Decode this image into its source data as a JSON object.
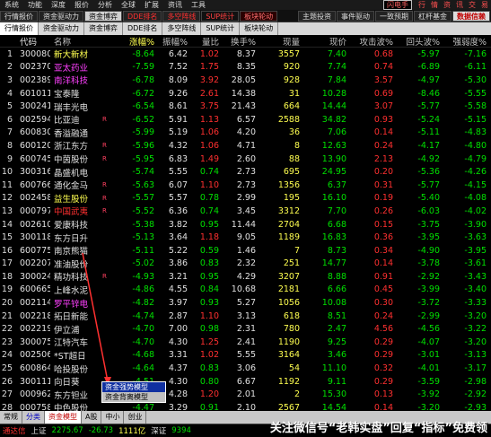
{
  "menubar": {
    "items": [
      "系统",
      "功能",
      "深度",
      "报价",
      "分析",
      "全球",
      "扩展",
      "资讯",
      "工具"
    ],
    "right": {
      "box": "闪电手",
      "items": [
        "行",
        "情",
        "资",
        "讯",
        "交",
        "易"
      ]
    }
  },
  "toolbar": {
    "items": [
      "行情报价",
      "资金驱动力",
      "资金博弈",
      "DDE排名",
      "多空阵线",
      "SUP统计",
      "板块轮动"
    ],
    "right": [
      "主题投资",
      "事件驱动",
      "一致预期",
      "杠杆基金",
      "数据信赖"
    ]
  },
  "subtoolbar": {
    "items": [
      "行情报价",
      "资金驱动力",
      "资金博弈",
      "DDE排名",
      "多空阵线",
      "SUP统计",
      "板块轮动"
    ]
  },
  "table": {
    "headers": [
      "",
      "代码",
      "名称",
      "涨幅%",
      "振幅%",
      "量比",
      "换手%",
      "现量",
      "现价",
      "攻击波%",
      "回头波%",
      "强弱度%"
    ],
    "rows": [
      {
        "n": "1",
        "code": "300080",
        "name": "新大新材",
        "flag": "",
        "chg": "-8.64",
        "amp": "6.42",
        "lb": "1.02",
        "hs": "8.37",
        "xl": "3557",
        "xj": "7.40",
        "gjb": "0.68",
        "htb": "-5.97",
        "qrd": "-7.16",
        "nc": "yel"
      },
      {
        "n": "2",
        "code": "002370",
        "name": "亚太药业",
        "flag": "",
        "chg": "-7.59",
        "amp": "7.52",
        "lb": "1.75",
        "hs": "8.35",
        "xl": "920",
        "xj": "7.74",
        "gjb": "0.74",
        "htb": "-6.89",
        "qrd": "-6.11",
        "nc": "mg"
      },
      {
        "n": "3",
        "code": "002389",
        "name": "南洋科技",
        "flag": "",
        "chg": "-6.78",
        "amp": "8.09",
        "lb": "3.92",
        "hs": "28.05",
        "xl": "928",
        "xj": "7.84",
        "gjb": "3.57",
        "htb": "-4.97",
        "qrd": "-5.30",
        "nc": "mg"
      },
      {
        "n": "4",
        "code": "601011",
        "name": "宝泰隆",
        "flag": "",
        "chg": "-6.72",
        "amp": "9.26",
        "lb": "2.61",
        "hs": "14.38",
        "xl": "31",
        "xj": "10.28",
        "gjb": "0.69",
        "htb": "-8.46",
        "qrd": "-5.55",
        "nc": "wh"
      },
      {
        "n": "5",
        "code": "300241",
        "name": "瑞丰光电",
        "flag": "",
        "chg": "-6.54",
        "amp": "8.61",
        "lb": "3.75",
        "hs": "21.43",
        "xl": "664",
        "xj": "14.44",
        "gjb": "3.07",
        "htb": "-5.77",
        "qrd": "-5.58",
        "nc": "wh"
      },
      {
        "n": "6",
        "code": "002594",
        "name": "比亚迪",
        "flag": "R",
        "chg": "-6.52",
        "amp": "5.91",
        "lb": "1.13",
        "hs": "6.57",
        "xl": "2588",
        "xj": "34.82",
        "gjb": "0.93",
        "htb": "-5.24",
        "qrd": "-5.15",
        "nc": "wh"
      },
      {
        "n": "7",
        "code": "600830",
        "name": "香溢融通",
        "flag": "",
        "chg": "-5.99",
        "amp": "5.19",
        "lb": "1.06",
        "hs": "4.20",
        "xl": "36",
        "xj": "7.06",
        "gjb": "0.14",
        "htb": "-5.11",
        "qrd": "-4.83",
        "nc": "wh"
      },
      {
        "n": "8",
        "code": "600120",
        "name": "浙江东方",
        "flag": "R",
        "chg": "-5.96",
        "amp": "4.32",
        "lb": "1.06",
        "hs": "4.71",
        "xl": "8",
        "xj": "12.63",
        "gjb": "0.24",
        "htb": "-4.17",
        "qrd": "-4.80",
        "nc": "wh"
      },
      {
        "n": "9",
        "code": "600745",
        "name": "中茵股份",
        "flag": "R",
        "chg": "-5.95",
        "amp": "6.83",
        "lb": "1.49",
        "hs": "2.60",
        "xl": "88",
        "xj": "13.90",
        "gjb": "2.13",
        "htb": "-4.92",
        "qrd": "-4.79",
        "nc": "wh"
      },
      {
        "n": "10",
        "code": "300316",
        "name": "晶盛机电",
        "flag": "",
        "chg": "-5.74",
        "amp": "5.55",
        "lb": "0.74",
        "hs": "2.73",
        "xl": "695",
        "xj": "24.95",
        "gjb": "0.20",
        "htb": "-5.36",
        "qrd": "-4.26",
        "nc": "wh"
      },
      {
        "n": "11",
        "code": "600766",
        "name": "通化金马",
        "flag": "R",
        "chg": "-5.63",
        "amp": "6.07",
        "lb": "1.10",
        "hs": "2.73",
        "xl": "1356",
        "xj": "6.37",
        "gjb": "0.31",
        "htb": "-5.77",
        "qrd": "-4.15",
        "nc": "wh"
      },
      {
        "n": "12",
        "code": "002458",
        "name": "益生股份",
        "flag": "R",
        "chg": "-5.57",
        "amp": "5.57",
        "lb": "0.78",
        "hs": "2.99",
        "xl": "195",
        "xj": "16.10",
        "gjb": "0.19",
        "htb": "-5.40",
        "qrd": "-4.08",
        "nc": "yel"
      },
      {
        "n": "13",
        "code": "000797",
        "name": "中国武夷",
        "flag": "R",
        "chg": "-5.52",
        "amp": "6.36",
        "lb": "0.74",
        "hs": "3.45",
        "xl": "3312",
        "xj": "7.70",
        "gjb": "0.26",
        "htb": "-6.03",
        "qrd": "-4.02",
        "nc": "nm-red"
      },
      {
        "n": "14",
        "code": "002610",
        "name": "爱康科技",
        "flag": "",
        "chg": "-5.38",
        "amp": "3.82",
        "lb": "0.95",
        "hs": "11.44",
        "xl": "2704",
        "xj": "6.68",
        "gjb": "0.15",
        "htb": "-3.75",
        "qrd": "-3.90",
        "nc": "wh"
      },
      {
        "n": "15",
        "code": "300118",
        "name": "东方日升",
        "flag": "",
        "chg": "-5.13",
        "amp": "3.64",
        "lb": "1.18",
        "hs": "9.05",
        "xl": "1189",
        "xj": "16.83",
        "gjb": "0.36",
        "htb": "-3.95",
        "qrd": "-3.63",
        "nc": "wh"
      },
      {
        "n": "16",
        "code": "600775",
        "name": "南京熊猫",
        "flag": "",
        "chg": "-5.11",
        "amp": "5.22",
        "lb": "0.59",
        "hs": "1.46",
        "xl": "7",
        "xj": "8.73",
        "gjb": "0.34",
        "htb": "-4.90",
        "qrd": "-3.95",
        "nc": "wh"
      },
      {
        "n": "17",
        "code": "002207",
        "name": "准油股份",
        "flag": "",
        "chg": "-5.02",
        "amp": "3.86",
        "lb": "0.83",
        "hs": "2.32",
        "xl": "251",
        "xj": "14.77",
        "gjb": "0.14",
        "htb": "-3.78",
        "qrd": "-3.61",
        "nc": "wh"
      },
      {
        "n": "18",
        "code": "300024",
        "name": "精功科技",
        "flag": "R",
        "chg": "-4.93",
        "amp": "3.21",
        "lb": "0.95",
        "hs": "4.29",
        "xl": "3207",
        "xj": "8.88",
        "gjb": "0.91",
        "htb": "-2.92",
        "qrd": "-3.43",
        "nc": "wh"
      },
      {
        "n": "19",
        "code": "600665",
        "name": "上峰水泥",
        "flag": "",
        "chg": "-4.86",
        "amp": "4.55",
        "lb": "0.84",
        "hs": "10.68",
        "xl": "2181",
        "xj": "6.66",
        "gjb": "0.45",
        "htb": "-3.99",
        "qrd": "-3.40",
        "nc": "wh"
      },
      {
        "n": "20",
        "code": "002114",
        "name": "罗平锌电",
        "flag": "",
        "chg": "-4.82",
        "amp": "3.97",
        "lb": "0.93",
        "hs": "5.27",
        "xl": "1056",
        "xj": "10.08",
        "gjb": "0.30",
        "htb": "-3.72",
        "qrd": "-3.33",
        "nc": "mg"
      },
      {
        "n": "21",
        "code": "002218",
        "name": "拓日新能",
        "flag": "",
        "chg": "-4.74",
        "amp": "2.87",
        "lb": "1.10",
        "hs": "3.13",
        "xl": "618",
        "xj": "8.51",
        "gjb": "0.24",
        "htb": "-2.99",
        "qrd": "-3.20",
        "nc": "wh"
      },
      {
        "n": "22",
        "code": "002219",
        "name": "伊立浦",
        "flag": "",
        "chg": "-4.70",
        "amp": "7.00",
        "lb": "0.98",
        "hs": "2.31",
        "xl": "780",
        "xj": "2.47",
        "gjb": "4.56",
        "htb": "-4.56",
        "qrd": "-3.22",
        "nc": "wh"
      },
      {
        "n": "23",
        "code": "300075",
        "name": "江特汽车",
        "flag": "",
        "chg": "-4.70",
        "amp": "4.30",
        "lb": "1.25",
        "hs": "2.41",
        "xl": "1190",
        "xj": "9.25",
        "gjb": "0.29",
        "htb": "-4.07",
        "qrd": "-3.20",
        "nc": "wh"
      },
      {
        "n": "24",
        "code": "002506",
        "name": "*ST超日",
        "flag": "",
        "chg": "-4.68",
        "amp": "3.31",
        "lb": "1.02",
        "hs": "5.55",
        "xl": "3164",
        "xj": "3.46",
        "gjb": "0.29",
        "htb": "-3.01",
        "qrd": "-3.13",
        "nc": "wh"
      },
      {
        "n": "25",
        "code": "600864",
        "name": "哈投股份",
        "flag": "",
        "chg": "-4.64",
        "amp": "4.37",
        "lb": "0.83",
        "hs": "3.06",
        "xl": "54",
        "xj": "11.10",
        "gjb": "0.32",
        "htb": "-4.01",
        "qrd": "-3.17",
        "nc": "wh"
      },
      {
        "n": "26",
        "code": "300111",
        "name": "向日葵",
        "flag": "",
        "chg": "-4.51",
        "amp": "4.30",
        "lb": "0.80",
        "hs": "6.67",
        "xl": "1192",
        "xj": "9.11",
        "gjb": "0.29",
        "htb": "-3.59",
        "qrd": "-2.98",
        "nc": "wh"
      },
      {
        "n": "27",
        "code": "000962",
        "name": "东方钽业",
        "flag": "",
        "chg": "-4.49",
        "amp": "4.28",
        "lb": "1.20",
        "hs": "2.01",
        "xl": "2",
        "xj": "15.30",
        "gjb": "0.13",
        "htb": "-3.92",
        "qrd": "-2.92",
        "nc": "wh"
      },
      {
        "n": "28",
        "code": "000758",
        "name": "中色股份",
        "flag": "",
        "chg": "-4.47",
        "amp": "3.29",
        "lb": "0.91",
        "hs": "2.10",
        "xl": "2567",
        "xj": "14.54",
        "gjb": "0.14",
        "htb": "-3.20",
        "qrd": "-2.93",
        "nc": "wh"
      }
    ]
  },
  "context_menu": {
    "items": [
      "资金强势模型",
      "资金背离模型"
    ]
  },
  "tabbar": {
    "items": [
      "常规",
      "分类",
      "资金模型",
      "A股",
      "中小",
      "创业"
    ]
  },
  "statusbar": {
    "label": "通达信",
    "market": "上证",
    "value": "2275.67",
    "change": "-26.73",
    "volume": "1111亿",
    "market2": "深证",
    "value2": "9394"
  },
  "watermark": "关注微信号“老韩实盘”回复“指标”免费领",
  "colors": {
    "up": "#ff3030",
    "down": "#00e000",
    "name": "#ffff50",
    "selected": "#1030a0"
  }
}
